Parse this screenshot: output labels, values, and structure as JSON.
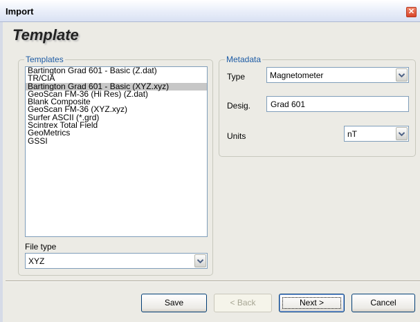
{
  "window": {
    "title": "Import",
    "close_glyph": "✕"
  },
  "page": {
    "heading": "Template"
  },
  "templates_group": {
    "legend": "Templates",
    "items": [
      "Bartington Grad 601 - Basic (Z.dat)",
      "TR/CIA",
      "Bartington Grad 601 - Basic (XYZ.xyz)",
      "GeoScan FM-36 (Hi Res) (Z.dat)",
      "Blank Composite",
      "GeoScan FM-36 (XYZ.xyz)",
      "Surfer ASCII (*.grd)",
      "Scintrex Total Field",
      "GeoMetrics",
      "GSSI"
    ],
    "selected_index": 2,
    "file_type_label": "File type",
    "file_type_value": "XYZ"
  },
  "metadata_group": {
    "legend": "Metadata",
    "type_label": "Type",
    "type_value": "Magnetometer",
    "desig_label": "Desig.",
    "desig_value": "Grad 601",
    "units_label": "Units",
    "units_value": "nT"
  },
  "buttons": {
    "save": "Save",
    "back": "< Back",
    "next": "Next >",
    "cancel": "Cancel"
  },
  "icons": {
    "dropdown": "chevron-down-icon",
    "close": "close-icon"
  },
  "colors": {
    "legend": "#1d5ba4",
    "selection": "#c7c7c7",
    "close_button": "#d8442a"
  }
}
